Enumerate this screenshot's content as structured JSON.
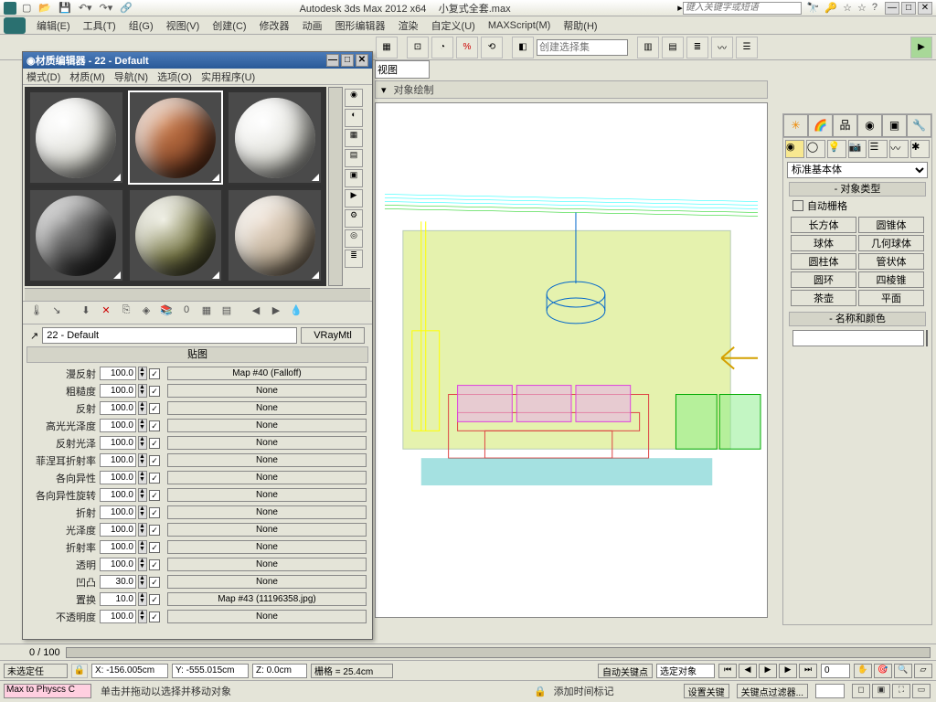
{
  "titlebar": {
    "app_title": "Autodesk 3ds Max  2012 x64",
    "file_name": "小复式全套.max",
    "search_placeholder": "键入关键字或短语"
  },
  "menubar": {
    "items": [
      "编辑(E)",
      "工具(T)",
      "组(G)",
      "视图(V)",
      "创建(C)",
      "修改器",
      "动画",
      "图形编辑器",
      "渲染",
      "自定义(U)",
      "MAXScript(M)",
      "帮助(H)"
    ]
  },
  "viewport_label": "视图",
  "object_paint": "对象绘制",
  "selection_set_placeholder": "创建选择集",
  "material_editor": {
    "title": "材质编辑器 - 22 - Default",
    "menu": [
      "模式(D)",
      "材质(M)",
      "导航(N)",
      "选项(O)",
      "实用程序(U)"
    ],
    "name_value": "22 - Default",
    "type_button": "VRayMtl",
    "section_header": "贴图",
    "params": [
      {
        "label": "漫反射",
        "value": "100.0",
        "checked": true,
        "map": "Map #40  (Falloff)"
      },
      {
        "label": "粗糙度",
        "value": "100.0",
        "checked": true,
        "map": "None"
      },
      {
        "label": "反射",
        "value": "100.0",
        "checked": true,
        "map": "None"
      },
      {
        "label": "高光光泽度",
        "value": "100.0",
        "checked": true,
        "map": "None"
      },
      {
        "label": "反射光泽",
        "value": "100.0",
        "checked": true,
        "map": "None"
      },
      {
        "label": "菲涅耳折射率",
        "value": "100.0",
        "checked": true,
        "map": "None"
      },
      {
        "label": "各向异性",
        "value": "100.0",
        "checked": true,
        "map": "None"
      },
      {
        "label": "各向异性旋转",
        "value": "100.0",
        "checked": true,
        "map": "None"
      },
      {
        "label": "折射",
        "value": "100.0",
        "checked": true,
        "map": "None"
      },
      {
        "label": "光泽度",
        "value": "100.0",
        "checked": true,
        "map": "None"
      },
      {
        "label": "折射率",
        "value": "100.0",
        "checked": true,
        "map": "None"
      },
      {
        "label": "透明",
        "value": "100.0",
        "checked": true,
        "map": "None"
      },
      {
        "label": "凹凸",
        "value": "30.0",
        "checked": true,
        "map": "None"
      },
      {
        "label": "置换",
        "value": "10.0",
        "checked": true,
        "map": "Map #43 (11196358.jpg)"
      },
      {
        "label": "不透明度",
        "value": "100.0",
        "checked": true,
        "map": "None"
      }
    ]
  },
  "command_panel": {
    "dropdown": "标准基本体",
    "section1": "对象类型",
    "autogrid": "自动栅格",
    "buttons": [
      "长方体",
      "圆锥体",
      "球体",
      "几何球体",
      "圆柱体",
      "管状体",
      "圆环",
      "四棱锥",
      "茶壶",
      "平面"
    ],
    "section2": "名称和颜色"
  },
  "timeline": {
    "label": "0 / 100"
  },
  "status": {
    "no_selection": "未选定任",
    "x": "X: -156.005cm",
    "y": "Y: -555.015cm",
    "z": "Z: 0.0cm",
    "grid": "栅格 = 25.4cm",
    "auto_key": "自动关键点",
    "selected": "选定对象",
    "set_key": "设置关键",
    "key_filter": "关键点过滤器...",
    "prompt": "单击并拖动以选择并移动对象",
    "add_time_tag": "添加时间标记"
  },
  "maxscript_listener": "Max to Physcs C"
}
